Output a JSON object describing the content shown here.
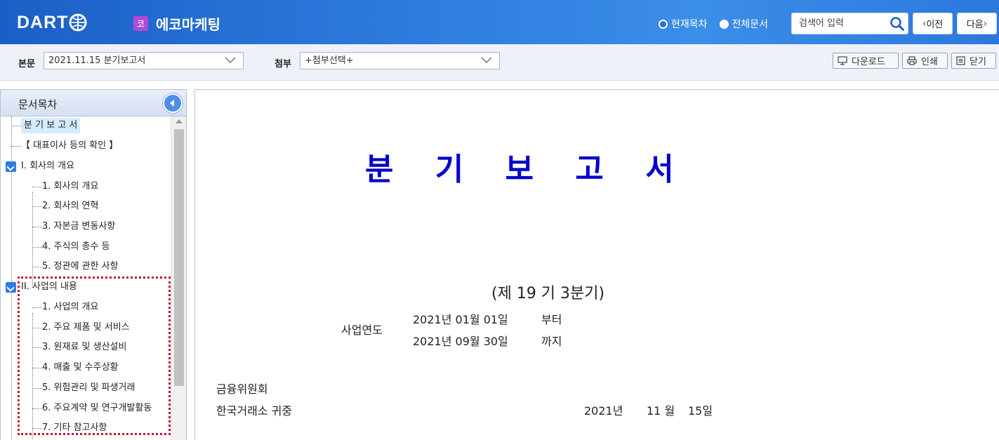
{
  "header": {
    "logo_text": "DART",
    "company_badge": "코",
    "company_name": "에코마케팅",
    "radio_current": "현재목차",
    "radio_all": "전체문서",
    "search_placeholder": "검색어 입력",
    "prev_label": "이전",
    "next_label": "다음"
  },
  "toolbar": {
    "main_label": "본문",
    "main_value": "2021.11.15  분기보고서",
    "attach_label": "첨부",
    "attach_value": "+첨부선택+",
    "download_label": "다운로드",
    "print_label": "인쇄",
    "close_label": "닫기"
  },
  "sidebar": {
    "title": "문서목차",
    "items": [
      "분 기 보 고 서",
      "【 대표이사 등의 확인 】",
      "I. 회사의 개요",
      "1. 회사의 개요",
      "2. 회사의 연혁",
      "3. 자본금 변동사항",
      "4. 주식의 총수 등",
      "5. 정관에 관한 사항",
      "II. 사업의 내용",
      "1. 사업의 개요",
      "2. 주요 제품 및 서비스",
      "3. 원재료 및 생산설비",
      "4. 매출 및 수주상황",
      "5. 위험관리 및 파생거래",
      "6. 주요계약 및 연구개발활동",
      "7. 기타 참고사항"
    ]
  },
  "document": {
    "title": "분 기 보 고 서",
    "period": "(제 19 기 3분기)",
    "fiscal_label": "사업연도",
    "start_date": "2021년 01월 01일",
    "start_suffix": "부터",
    "end_date": "2021년 09월 30일",
    "end_suffix": "까지",
    "recipient1": "금융위원회",
    "recipient2": "한국거래소 귀중",
    "report_year": "2021년",
    "report_month": "11 월",
    "report_day": "15일"
  },
  "colors": {
    "header_blue": "#2f7ee0",
    "title_blue": "#0000cc",
    "highlight_red": "#c8102e",
    "badge_purple": "#b04ad6"
  }
}
